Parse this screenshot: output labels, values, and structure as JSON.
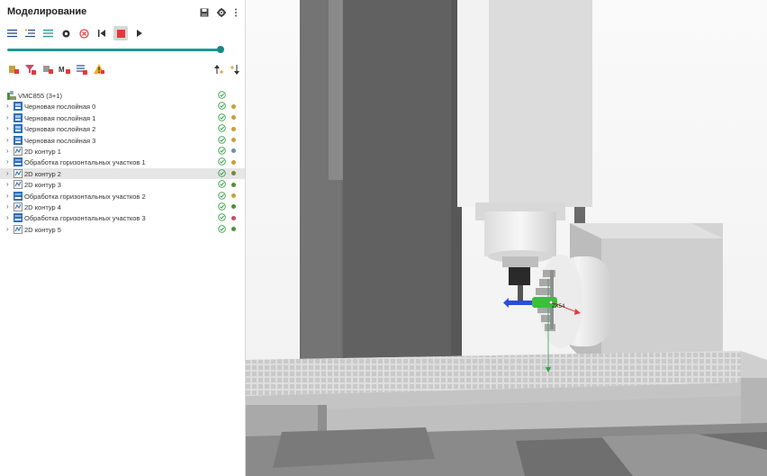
{
  "panel": {
    "title": "Моделирование",
    "header_icons": [
      "save-icon",
      "gear-icon",
      "more-vertical-icon"
    ]
  },
  "colors": {
    "accent": "#1a9c93",
    "stop": "#e03a3a",
    "folder_blue": "#2f6fb7",
    "check": "#3aa04a"
  },
  "tree": {
    "root": {
      "label": "VMC855 (3+1)"
    },
    "items": [
      {
        "label": "Черновая послойная 0",
        "type": "roughing",
        "dot": "#c9a03a",
        "selected": false
      },
      {
        "label": "Черновая послойная 1",
        "type": "roughing",
        "dot": "#c9a03a",
        "selected": false
      },
      {
        "label": "Черновая послойная 2",
        "type": "roughing",
        "dot": "#c9a03a",
        "selected": false
      },
      {
        "label": "Черновая послойная 3",
        "type": "roughing",
        "dot": "#c9a03a",
        "selected": false
      },
      {
        "label": "2D контур 1",
        "type": "contour",
        "dot": "#6e8fb0",
        "selected": false
      },
      {
        "label": "Обработка горизонтальных участков 1",
        "type": "horizontal",
        "dot": "#c9a03a",
        "selected": false
      },
      {
        "label": "2D контур 2",
        "type": "contour",
        "dot": "#6f8b3a",
        "selected": true
      },
      {
        "label": "2D контур 3",
        "type": "contour",
        "dot": "#4f8f3a",
        "selected": false
      },
      {
        "label": "Обработка горизонтальных участков 2",
        "type": "horizontal",
        "dot": "#c9a03a",
        "selected": false
      },
      {
        "label": "2D контур 4",
        "type": "contour",
        "dot": "#4f8f3a",
        "selected": false
      },
      {
        "label": "Обработка горизонтальных участков 3",
        "type": "horizontal",
        "dot": "#c94a6a",
        "selected": false
      },
      {
        "label": "2D контур 5",
        "type": "contour",
        "dot": "#4f8f3a",
        "selected": false
      }
    ]
  },
  "viewport": {
    "axis_label": "ZX54"
  }
}
